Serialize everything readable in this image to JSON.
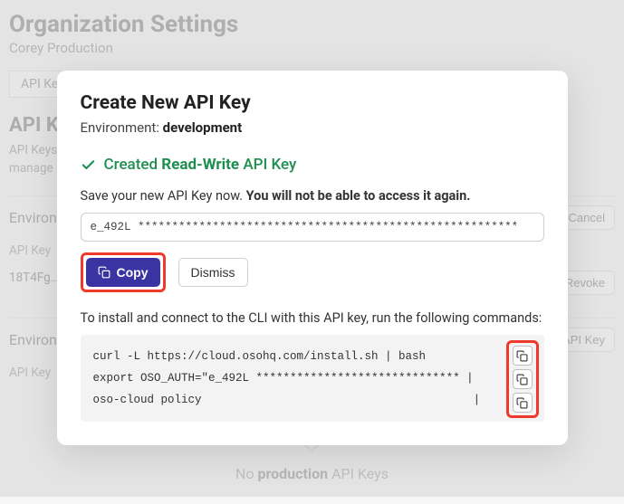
{
  "header": {
    "title": "Organization Settings",
    "subtitle": "Corey Production"
  },
  "tabs": [
    "API Keys"
  ],
  "section": {
    "title": "API Keys",
    "desc": "API Keys are used for interacting with the Oso Cloud API in a specific environment. You can create and manage as many as you'd like, and revoke them at any time."
  },
  "envs": [
    {
      "label": "Environment: development",
      "btns": [
        "Cancel"
      ],
      "header": [
        "API Key"
      ],
      "rows": [
        {
          "key": "18T4Fg…",
          "perm": "",
          "created": "",
          "action": "Revoke"
        }
      ]
    },
    {
      "label": "Environment: production",
      "btns": [
        "New API Key"
      ],
      "header": [
        "API Key"
      ],
      "rows": []
    }
  ],
  "empty": {
    "prefix": "No ",
    "bold": "production",
    "suffix": " API Keys"
  },
  "modal": {
    "title": "Create New API Key",
    "env_label": "Environment: ",
    "env_value": "development",
    "success_prefix": "Created ",
    "success_bold": "Read-Write",
    "success_suffix": " API Key",
    "save_note_prefix": "Save your new API Key now. ",
    "save_note_bold": "You will not be able to access it again.",
    "key_display": "e_492L ********************************************************",
    "copy_label": "Copy",
    "dismiss_label": "Dismiss",
    "install_note": "To install and connect to the CLI with this API key, run the following commands:",
    "code_lines": [
      "curl -L https://cloud.osohq.com/install.sh | bash",
      "export OSO_AUTH=\"e_492L ****************************** |",
      "oso-cloud policy                                        |"
    ]
  }
}
